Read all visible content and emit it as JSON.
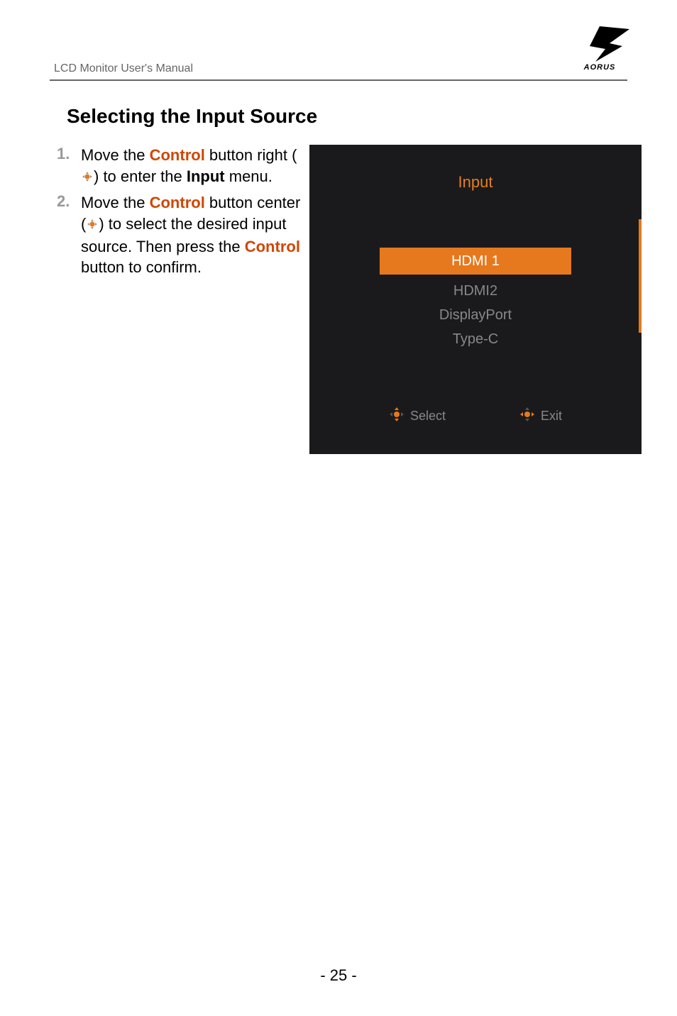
{
  "header": {
    "manual_title": "LCD Monitor User's Manual",
    "brand": "AORUS"
  },
  "section": {
    "title": "Selecting the Input Source"
  },
  "steps": {
    "item1": {
      "num": "1.",
      "t1": "Move the ",
      "control": "Control",
      "t2": " button right (",
      "t3": ") to enter the ",
      "input_kw": "Input",
      "t4": " menu."
    },
    "item2": {
      "num": "2.",
      "t1": "Move the ",
      "control": "Control",
      "t2": " button center (",
      "t3": ") to select the desired input source. Then press the ",
      "control2": "Control",
      "t4": " button to confirm."
    }
  },
  "osd": {
    "title": "Input",
    "options": {
      "selected": "HDMI 1",
      "opt2": "HDMI2",
      "opt3": "DisplayPort",
      "opt4": "Type-C"
    },
    "hints": {
      "select": "Select",
      "exit": "Exit"
    }
  },
  "footer": {
    "page": "- 25 -"
  }
}
